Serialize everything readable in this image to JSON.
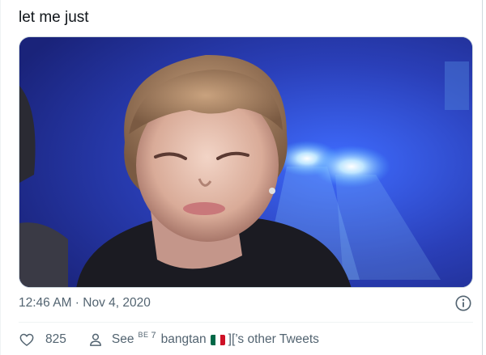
{
  "tweet": {
    "text": "let me just",
    "timestamp": "12:46 AM · Nov 4, 2020",
    "like_count": "825",
    "see_prefix": "See",
    "see_sup": "BE",
    "see_seven": "7",
    "see_name": "bangtan",
    "see_suffix": "][’s other Tweets"
  },
  "icons": {
    "like": "heart-icon",
    "profile": "person-icon",
    "info": "info-icon",
    "flag": "mexico-flag-icon"
  },
  "colors": {
    "secondary_text": "#536471",
    "border": "#cfd9de",
    "flag_green": "#006847",
    "flag_white": "#ffffff",
    "flag_red": "#ce1126"
  }
}
